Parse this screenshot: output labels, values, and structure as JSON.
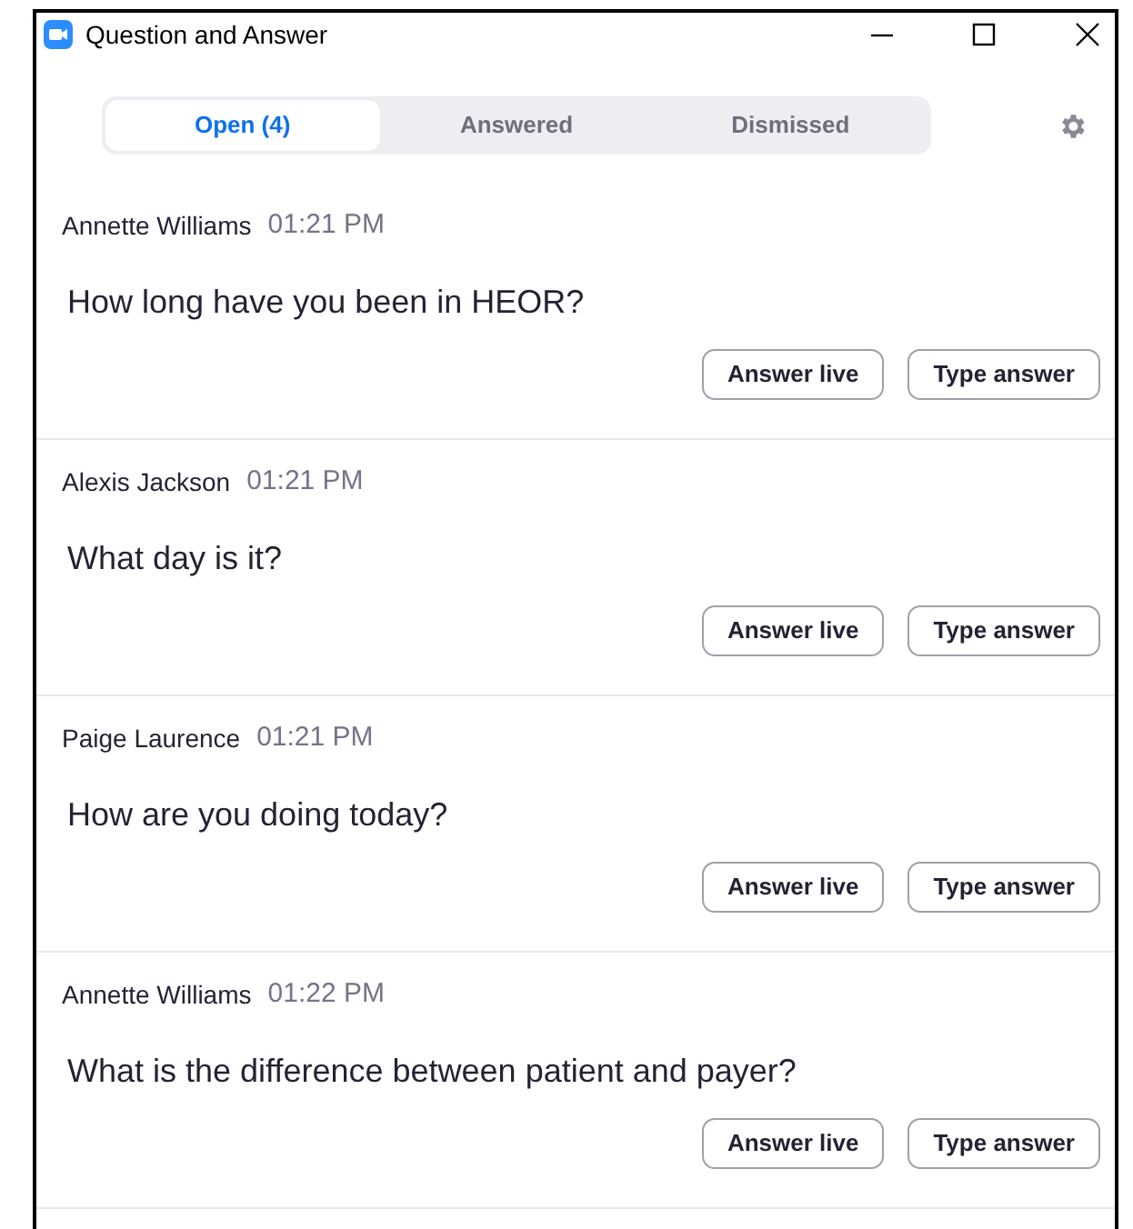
{
  "window": {
    "title": "Question and Answer"
  },
  "tabs": [
    {
      "label": "Open (4)",
      "selected": true
    },
    {
      "label": "Answered",
      "selected": false
    },
    {
      "label": "Dismissed",
      "selected": false
    }
  ],
  "questions": [
    {
      "author": "Annette Williams",
      "time": "01:21 PM",
      "text": "How long have you been in HEOR?",
      "actions": [
        "Answer live",
        "Type answer"
      ]
    },
    {
      "author": "Alexis Jackson",
      "time": "01:21 PM",
      "text": "What day is it?",
      "actions": [
        "Answer live",
        "Type answer"
      ]
    },
    {
      "author": "Paige Laurence",
      "time": "01:21 PM",
      "text": "How are you doing today?",
      "actions": [
        "Answer live",
        "Type answer"
      ]
    },
    {
      "author": "Annette Williams",
      "time": "01:22 PM",
      "text": "What is the difference between patient and payer?",
      "actions": [
        "Answer live",
        "Type answer"
      ]
    }
  ]
}
